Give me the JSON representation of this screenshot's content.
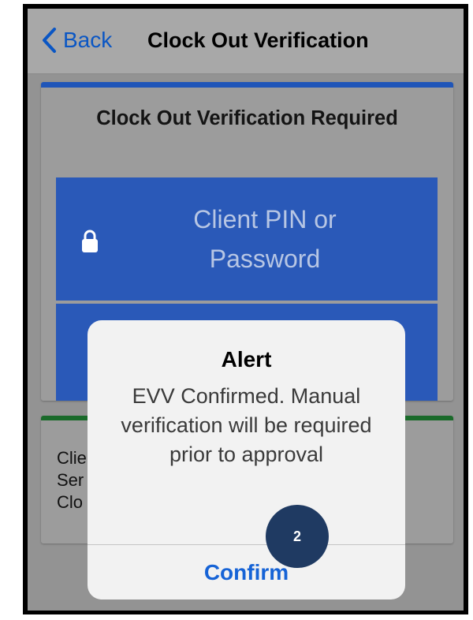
{
  "navbar": {
    "back_label": "Back",
    "title": "Clock Out Verification"
  },
  "verification_card": {
    "title": "Clock Out Verification Required",
    "pin_field": {
      "placeholder": "Client PIN or Password",
      "icon": "lock-icon"
    }
  },
  "details_card": {
    "lines": [
      "Clie",
      "Ser",
      "Clo"
    ]
  },
  "alert": {
    "title": "Alert",
    "message": "EVV Confirmed. Manual verification will be required prior to approval",
    "confirm_label": "Confirm"
  },
  "step_badge": {
    "label": "2"
  },
  "colors": {
    "accent_blue": "#2a59b8",
    "link_blue": "#1663d6",
    "success_green": "#1a6a2a",
    "badge_navy": "#1f3a62"
  }
}
